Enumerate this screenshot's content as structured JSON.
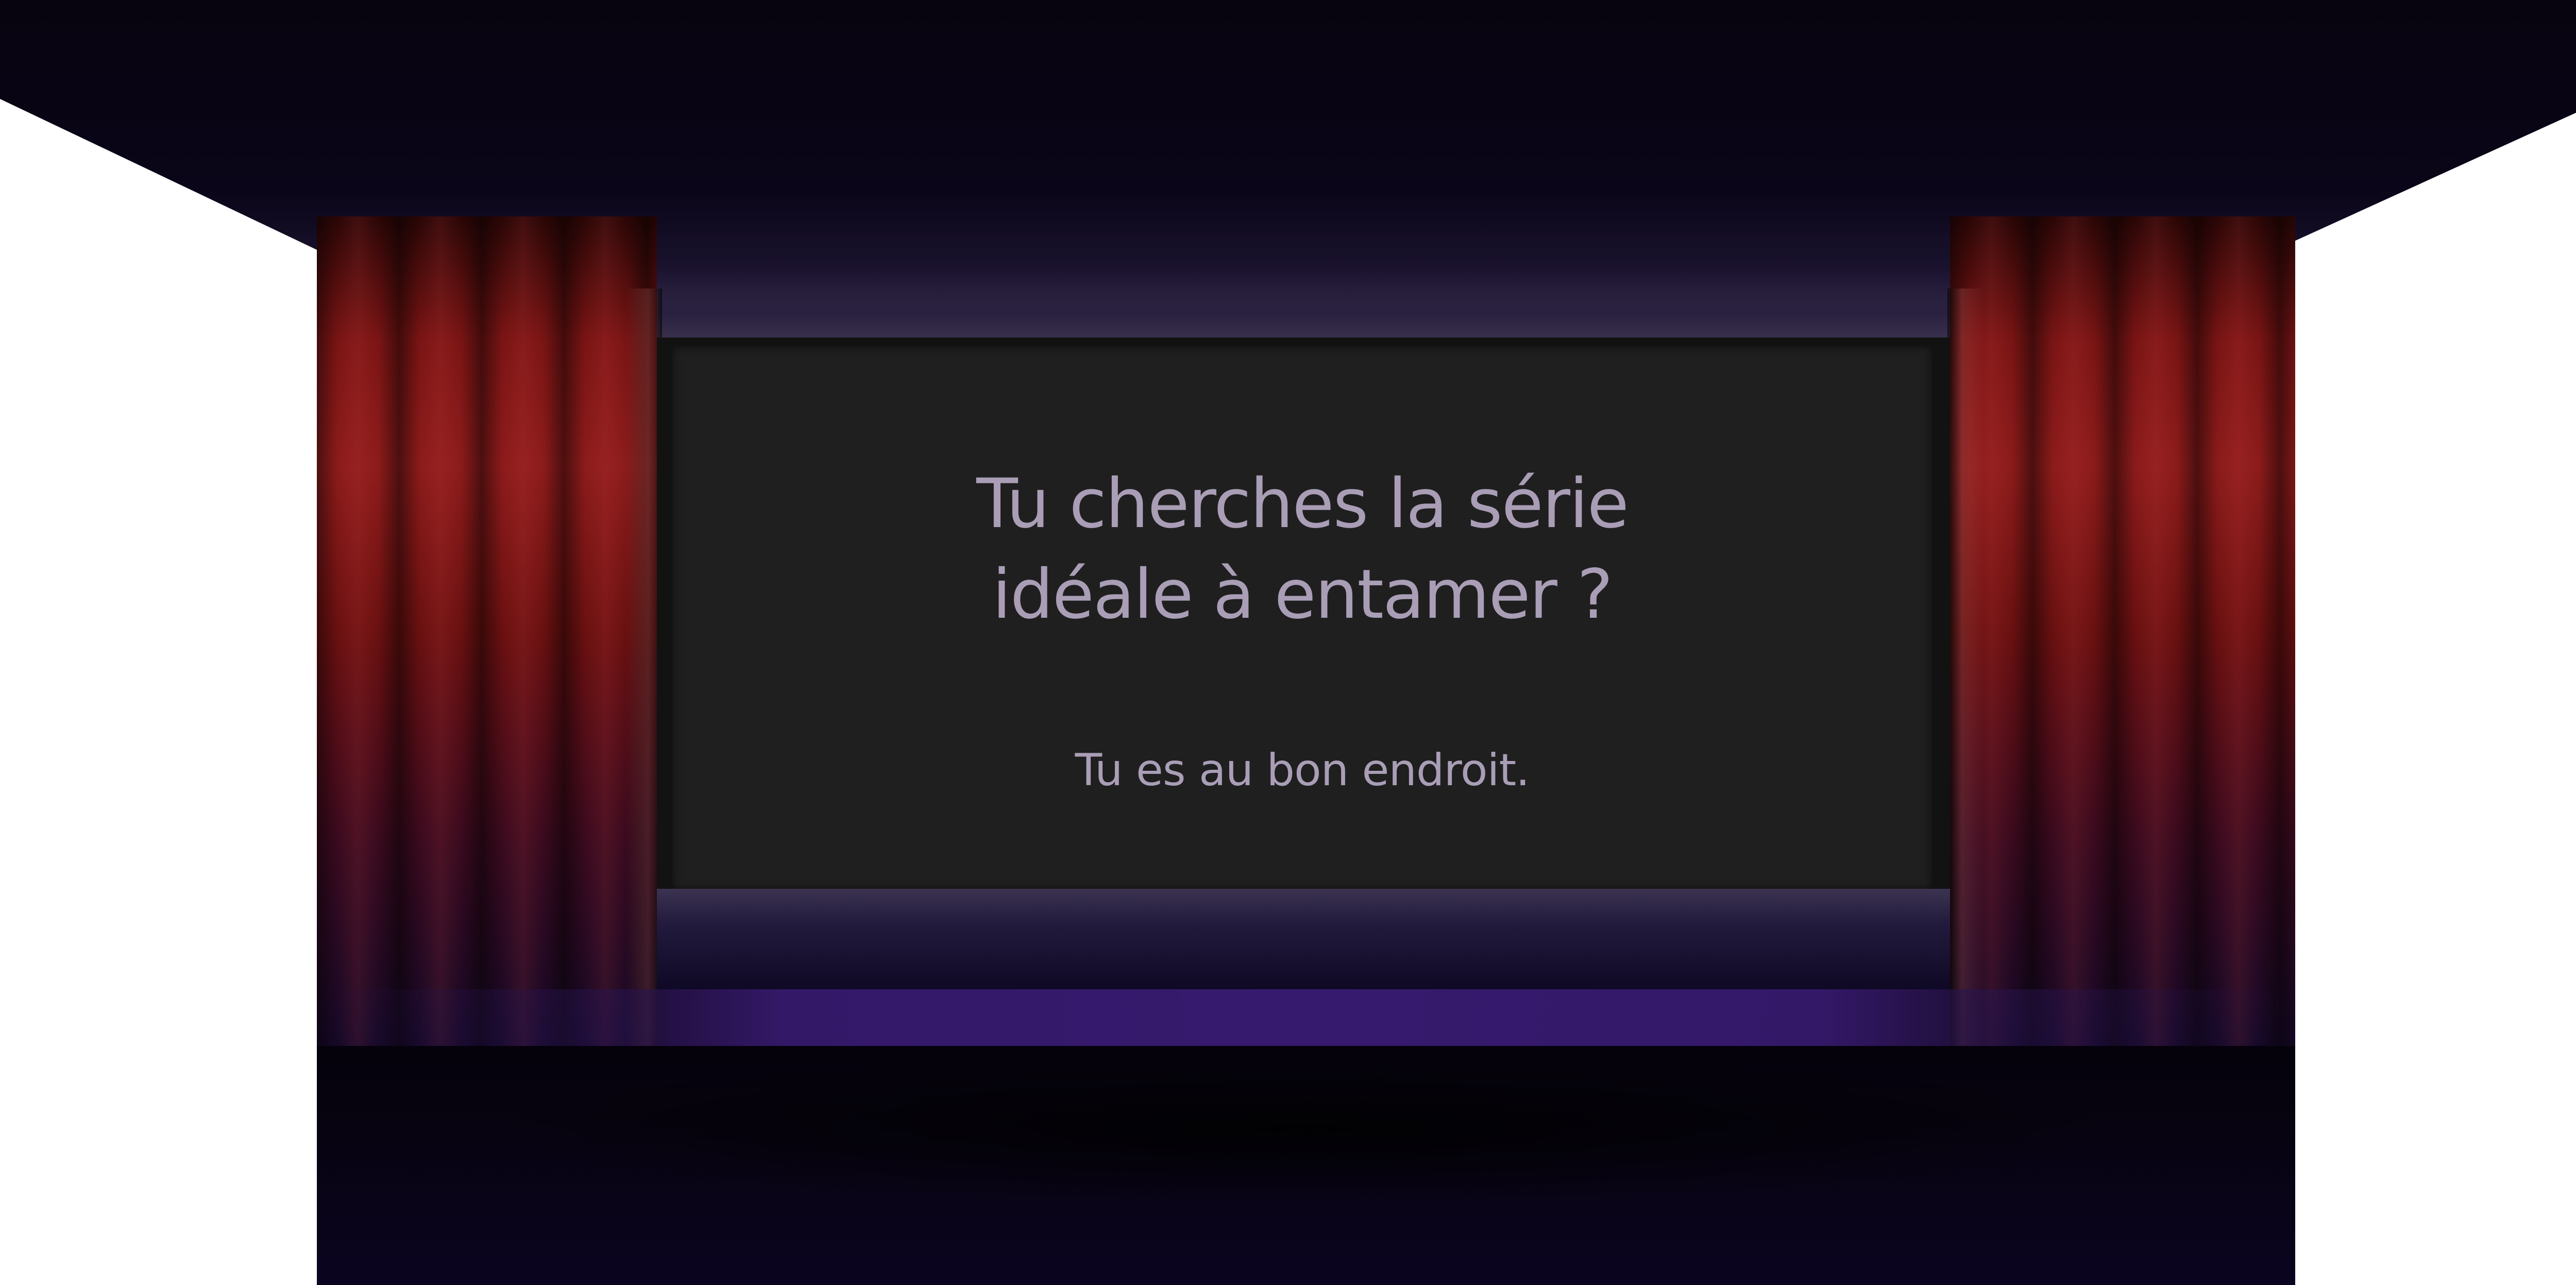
{
  "hero": {
    "headline_lines": [
      "Tu cherches la série",
      "idéale à entamer ?"
    ],
    "subline": "Tu es au bon endroit."
  },
  "colors": {
    "text": "#a99eb6",
    "screen": "#1f1f1f",
    "curtain": "#8c1b1b",
    "stage_strip": "#361a6e",
    "room": "#0a0418"
  }
}
